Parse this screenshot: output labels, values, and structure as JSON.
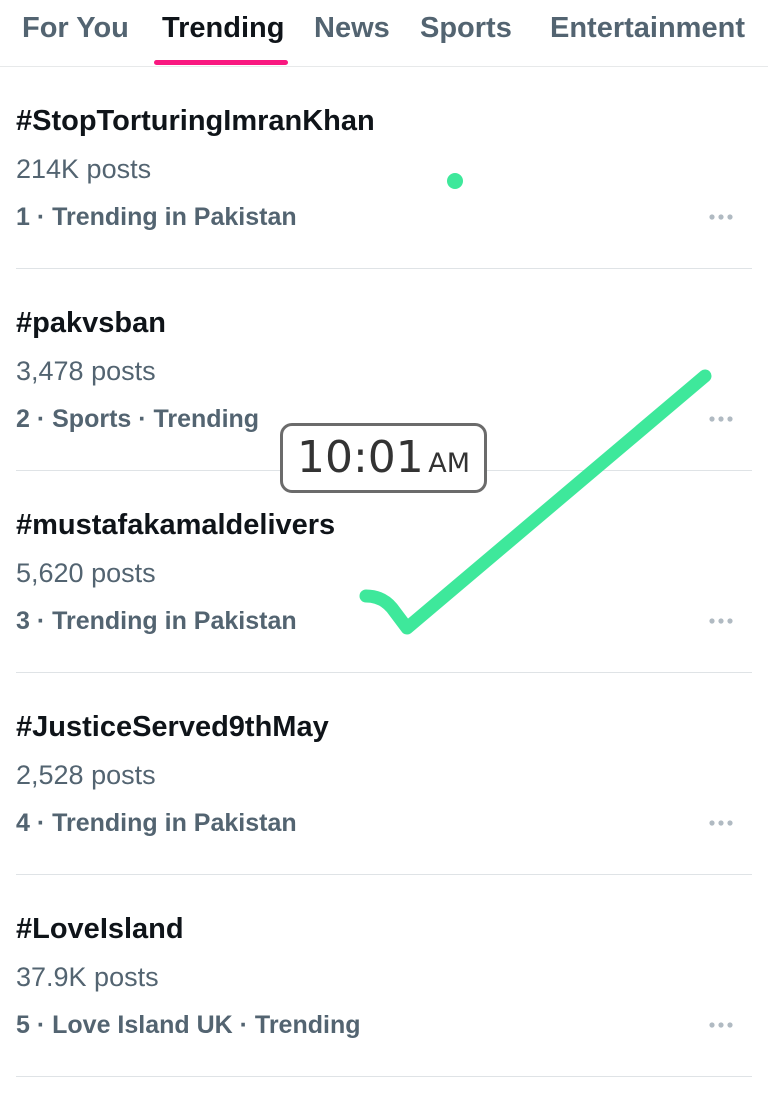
{
  "tabs": [
    {
      "label": "For You",
      "active": false
    },
    {
      "label": "Trending",
      "active": true
    },
    {
      "label": "News",
      "active": false
    },
    {
      "label": "Sports",
      "active": false
    },
    {
      "label": "Entertainment",
      "active": false
    }
  ],
  "trends": [
    {
      "hashtag": "#StopTorturingImranKhan",
      "posts": "214K posts",
      "context": "1 · Trending in Pakistan"
    },
    {
      "hashtag": "#pakvsban",
      "posts": "3,478 posts",
      "context": "2 · Sports · Trending"
    },
    {
      "hashtag": "#mustafakamaldelivers",
      "posts": "5,620 posts",
      "context": "3 · Trending in Pakistan"
    },
    {
      "hashtag": "#JusticeServed9thMay",
      "posts": "2,528 posts",
      "context": "4 · Trending in Pakistan"
    },
    {
      "hashtag": "#LoveIsland",
      "posts": "37.9K posts",
      "context": "5 · Love Island UK · Trending"
    }
  ],
  "time_overlay": {
    "time": "10:01",
    "ampm": "AM"
  },
  "icons": {
    "more": "more-horizontal-icon",
    "annotation": "checkmark-annotation"
  },
  "colors": {
    "accent": "#f91880",
    "text_primary": "#0f1419",
    "text_secondary": "#536471",
    "divider": "#dfe3e6",
    "annotation": "#3ee89b",
    "dots": "#b0bac2"
  }
}
